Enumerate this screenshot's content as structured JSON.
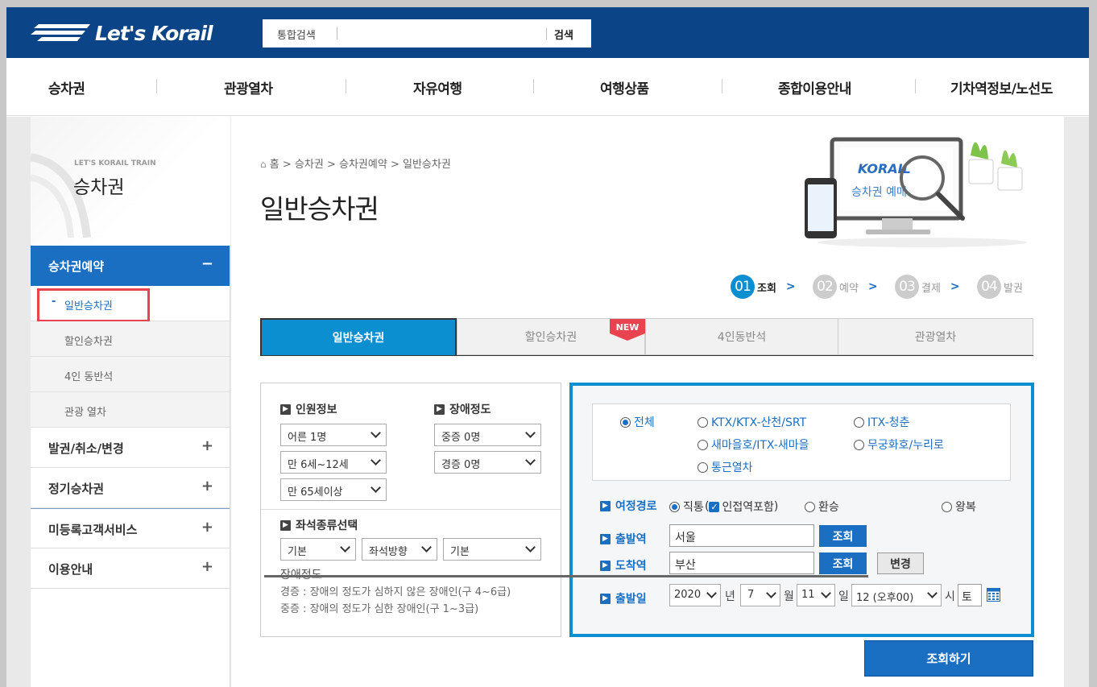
{
  "header": {
    "logo_text": "Let's Korail",
    "search": {
      "label": "통합검색",
      "value": "",
      "button": "검색"
    }
  },
  "gnb": [
    "승차권",
    "관광열차",
    "자유여행",
    "여행상품",
    "종합이용안내",
    "기차역정보/노선도"
  ],
  "sidebar": {
    "eyebrow": "LET'S KORAIL TRAIN",
    "title": "승차권",
    "active_menu": {
      "label": "승차권예약",
      "toggle": "−"
    },
    "sub_items": [
      {
        "label": "일반승차권",
        "prefix": "-"
      },
      {
        "label": "할인승차권"
      },
      {
        "label": "4인 동반석"
      },
      {
        "label": "관광 열차"
      }
    ],
    "menus": [
      {
        "label": "발권/취소/변경",
        "toggle": "+"
      },
      {
        "label": "정기승차권",
        "toggle": "+"
      },
      {
        "label": "미등록고객서비스",
        "toggle": "+"
      },
      {
        "label": "이용안내",
        "toggle": "+"
      }
    ]
  },
  "breadcrumb": [
    "홈",
    "승차권",
    "승차권예약",
    "일반승차권"
  ],
  "breadcrumb_sep": ">",
  "page_title": "일반승차권",
  "hero": {
    "brand": "KORAIL",
    "caption": "승차권 예매"
  },
  "steps": [
    {
      "num": "01",
      "label": "조회",
      "active": true
    },
    {
      "num": "02",
      "label": "예약"
    },
    {
      "num": "03",
      "label": "결제"
    },
    {
      "num": "04",
      "label": "발권"
    }
  ],
  "step_arrow": ">",
  "tabs": [
    "일반승차권",
    "할인승차권",
    "4인동반석",
    "관광열차"
  ],
  "new_badge": "NEW",
  "passenger": {
    "title": "인원정보",
    "adult": "어른 1명",
    "child": "만 6세~12세",
    "senior": "만 65세이상"
  },
  "disability": {
    "title": "장애정도",
    "severe": "중증 0명",
    "mild": "경증 0명"
  },
  "seat": {
    "title": "좌석종류선택",
    "type": "기본",
    "direction": "좌석방향",
    "option": "기본"
  },
  "disability_note": {
    "title": "장애정도",
    "mild": "경증 : 장애의 정도가 심하지 않은 장애인(구 4~6급)",
    "severe": "중증 : 장애의 정도가 심한 장애인(구 1~3급)"
  },
  "train_types": [
    "전체",
    "KTX/KTX-산천/SRT",
    "ITX-청춘",
    "새마을호/ITX-새마을",
    "무궁화호/누리로",
    "통근열차"
  ],
  "route": {
    "label": "여정경로",
    "direct": "직통",
    "nearby": "인접역포함",
    "paren_open": "(",
    "paren_close": ")",
    "transfer": "환승",
    "round": "왕복"
  },
  "departure": {
    "label": "출발역",
    "value": "서울",
    "button": "조회"
  },
  "arrival": {
    "label": "도착역",
    "value": "부산",
    "button": "조회",
    "swap": "변경"
  },
  "date": {
    "label": "출발일",
    "year": "2020",
    "year_unit": "년",
    "month": "7",
    "month_unit": "월",
    "day": "11",
    "day_unit": "일",
    "hour": "12 (오후00)",
    "hour_unit": "시",
    "weekday": "토"
  },
  "submit": "조회하기",
  "colors": {
    "navy": "#0c4587",
    "blue": "#1a6fc3",
    "cyan": "#0b8fd1",
    "red": "#e8434f"
  }
}
